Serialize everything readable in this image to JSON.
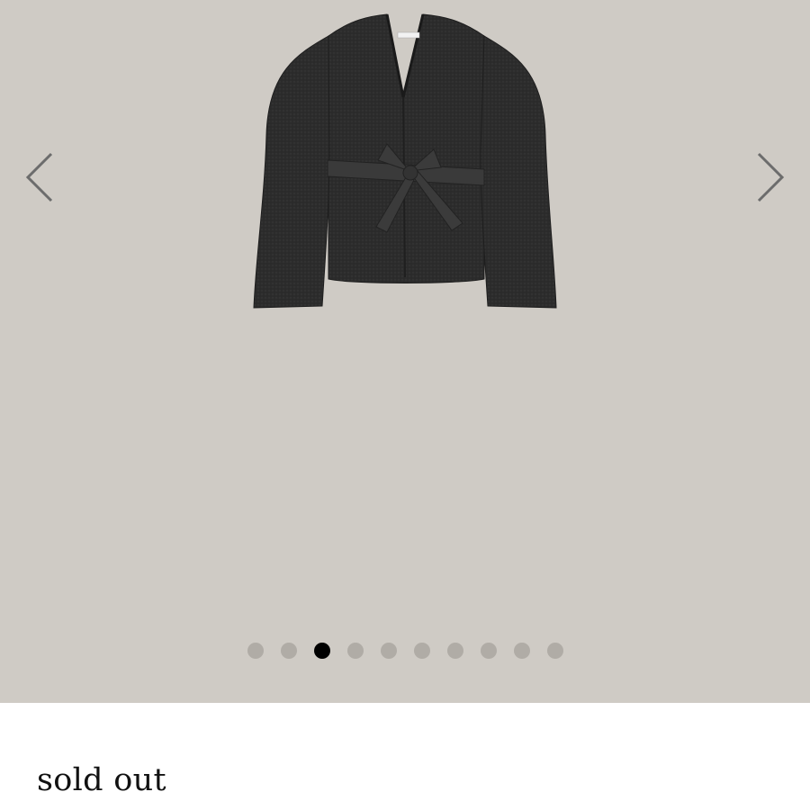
{
  "gallery": {
    "background_color": "#cfcbc5",
    "image": {
      "subject": "dark charcoal knit cardigan with tie belt"
    },
    "prev_icon": "chevron-left-icon",
    "next_icon": "chevron-right-icon",
    "dot_count": 10,
    "active_dot_index": 2,
    "dot_color": "#b0aca6",
    "active_dot_color": "#000000"
  },
  "product": {
    "status": "sold out"
  }
}
